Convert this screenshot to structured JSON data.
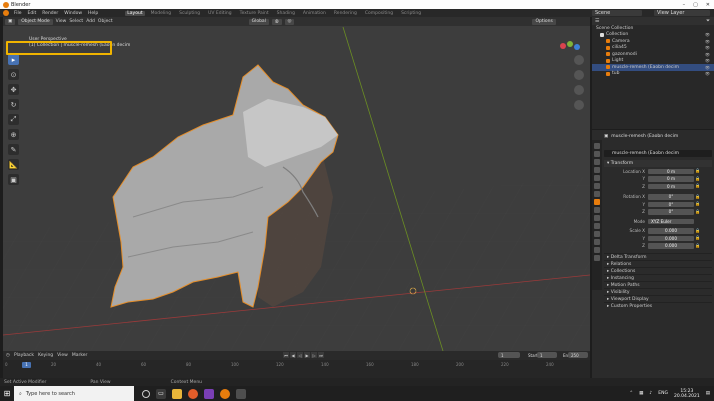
{
  "window": {
    "title": "Blender"
  },
  "menubar": {
    "items": [
      "File",
      "Edit",
      "Render",
      "Window",
      "Help"
    ],
    "workspaces": [
      "Layout",
      "Modeling",
      "Sculpting",
      "UV Editing",
      "Texture Paint",
      "Shading",
      "Animation",
      "Rendering",
      "Compositing",
      "Scripting"
    ],
    "scene": "Scene",
    "view_layer": "View Layer"
  },
  "viewport": {
    "mode": "Object Mode",
    "menu": [
      "View",
      "Select",
      "Add",
      "Object"
    ],
    "orientation": "Global",
    "perspective": "User Perspective",
    "collection_line": "(1) Collection | muscle-remesh (Eaobn decim",
    "options": "Options"
  },
  "outliner": {
    "title": "Scene Collection",
    "items": [
      {
        "label": "Collection",
        "selected": false
      },
      {
        "label": "Camera",
        "selected": false
      },
      {
        "label": "cilia45",
        "selected": false
      },
      {
        "label": "gazonmodi",
        "selected": false
      },
      {
        "label": "Light",
        "selected": false
      },
      {
        "label": "muscle-remesh (Eaobn decim",
        "selected": true
      },
      {
        "label": "tub",
        "selected": false
      }
    ]
  },
  "properties": {
    "object_title": "muscle-remesh (Eaobn decim",
    "object_name": "muscle-remesh (Eaobn decim",
    "transform_label": "Transform",
    "location_label": "Location X",
    "location": [
      "0 m",
      "0 m",
      "0 m"
    ],
    "rotation_label": "Rotation X",
    "rotation": [
      "0°",
      "0°",
      "0°"
    ],
    "mode_label": "Mode",
    "mode_value": "XYZ Euler",
    "scale_label": "Scale X",
    "scale": [
      "0.000",
      "0.000",
      "0.000"
    ],
    "y_label": "Y",
    "z_label": "Z",
    "sections": [
      "Delta Transform",
      "Relations",
      "Collections",
      "Instancing",
      "Motion Paths",
      "Visibility",
      "Viewport Display",
      "Custom Properties"
    ]
  },
  "playback": {
    "menu": [
      "Playback",
      "Keying",
      "View",
      "Marker"
    ],
    "current_frame": "1",
    "start_label": "Start",
    "start": "1",
    "end_label": "End",
    "end": "250",
    "ticks": [
      "0",
      "20",
      "40",
      "60",
      "80",
      "100",
      "120",
      "140",
      "160",
      "180",
      "200",
      "220",
      "240"
    ]
  },
  "statusbar": {
    "left": "Set Active Modifier",
    "middle": "Pan View",
    "right": "Context Menu"
  },
  "taskbar": {
    "search_placeholder": "Type here to search",
    "lang": "ENG",
    "time": "15:23",
    "date": "20.04.2021"
  },
  "colors": {
    "accent": "#e87d0d",
    "selection": "#4772b3",
    "highlight_box": "#f0b400"
  }
}
